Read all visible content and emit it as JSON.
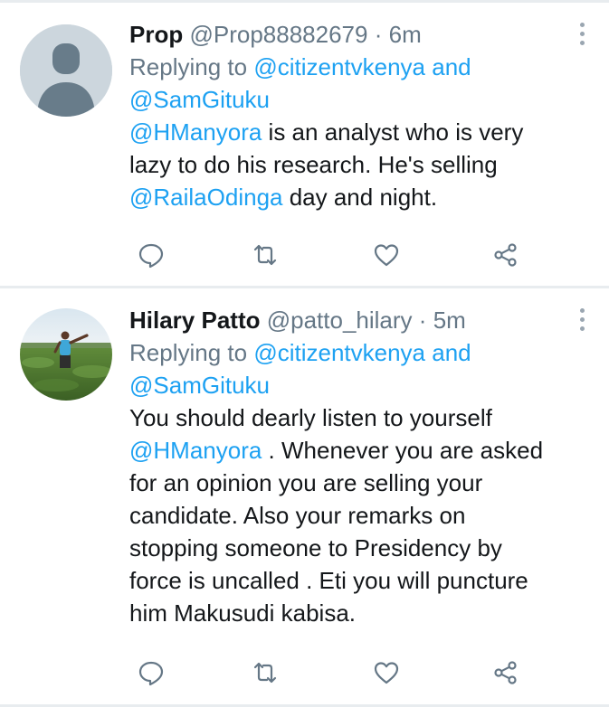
{
  "tweets": [
    {
      "name": "Prop",
      "handle": "@Prop88882679",
      "dot": "·",
      "time": "6m",
      "reply_prefix": "Replying to",
      "reply_mention_1": "@citizentvkenya",
      "reply_and": "and",
      "reply_mention_2": "@SamGituku",
      "text_line_1_mention": "@HManyora",
      "text_line_1_rest": " is an analyst who is very",
      "text_line_2": "lazy to do his research. He's selling",
      "text_line_3_mention": "@RailaOdinga",
      "text_line_3_rest": " day and night."
    },
    {
      "name": "Hilary Patto",
      "handle": "@patto_hilary",
      "dot": "·",
      "time": "5m",
      "reply_prefix": "Replying to",
      "reply_mention_1": "@citizentvkenya",
      "reply_and": "and",
      "reply_mention_2": "@SamGituku",
      "text_line_1": "You should dearly listen to yourself",
      "text_line_2_mention": "@HManyora",
      "text_line_2_rest": " . Whenever you are asked",
      "text_line_3": "for an opinion you are selling your",
      "text_line_4": "candidate. Also your remarks on",
      "text_line_5": "stopping someone to Presidency by",
      "text_line_6": "force is uncalled . Eti you will puncture",
      "text_line_7": "him Makusudi kabisa."
    }
  ],
  "icons": [
    "reply-icon",
    "retweet-icon",
    "like-icon",
    "share-icon",
    "more-options-icon"
  ],
  "colors": {
    "mention": "#1da1f2",
    "secondary": "#657786",
    "icon": "#657786",
    "divider": "#e8ecef"
  }
}
